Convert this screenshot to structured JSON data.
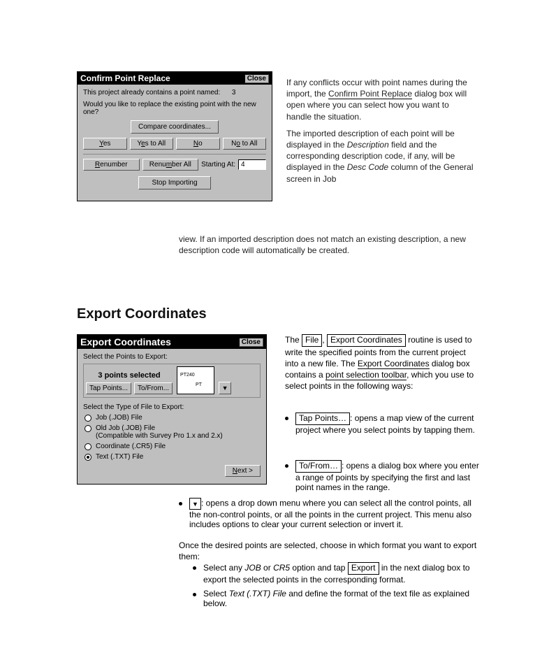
{
  "dialog1": {
    "title": "Confirm Point Replace",
    "close": "Close",
    "line1_prefix": "This project already contains a point named:",
    "line1_value": "3",
    "line2": "Would you like to replace the existing point with the new one?",
    "compare": "Compare coordinates...",
    "yes": "Yes",
    "yes_u": "Y",
    "yes_rest": "es",
    "yestoall": "Yes to All",
    "yta_pre": "Y",
    "yta_u": "e",
    "yta_post": "s to All",
    "no": "No",
    "no_u": "N",
    "no_rest": "o",
    "notoall": "No to All",
    "nta_pre": "N",
    "nta_u": "o",
    "nta_post": " to All",
    "renumber": "Renumber",
    "ren_u": "R",
    "ren_rest": "enumber",
    "renumberall": "Renumber All",
    "rena_pre": "Renu",
    "rena_u": "m",
    "rena_post": "ber All",
    "startingat": "Starting At:",
    "startingat_val": "4",
    "stop": "Stop Importing"
  },
  "rtext1": {
    "p1_pre": "If any conflicts occur with point names during the import, the ",
    "p1_em": "Confirm Point Replace",
    "p1_post": " dialog box will open where you can select how you want to handle the situation.",
    "p2_pre": "The imported description of each point will be displayed in the ",
    "p2_em": "Description",
    "p2_mid": " field and the corresponding description code, if any, will be displayed in the ",
    "p2_em2": "Desc Code",
    "p2_post": " column of the General screen in Job"
  },
  "midpara": {
    "text": "view. If an imported description does not match an existing description, a new description code will automatically be created."
  },
  "heading": "Export Coordinates",
  "dialog2": {
    "title": "Export Coordinates",
    "close": "Close",
    "select_points_label": "Select the Points to Export:",
    "sel_header": "3 points selected",
    "tap_points": "Tap Points...",
    "to_from": "To/From...",
    "map_pt1": "PT240",
    "map_pt2": "PT",
    "select_type_label": "Select the Type of File to Export:",
    "r1": "Job (.JOB) File",
    "r2a": "Old Job (.JOB) File",
    "r2b": "(Compatible with Survey Pro 1.x and 2.x)",
    "r3": "Coordinate (.CR5) File",
    "r4": "Text (.TXT) File",
    "next_u": "N",
    "next_rest": "ext >"
  },
  "rtext2": {
    "p1_pre": "The ",
    "p1_k1": "File",
    "p1_mid": ", ",
    "p1_k2": "Export Coordinates",
    "p1_post": " routine is used to write the specified points from the current project into a new file. The ",
    "p1_em1": "Export Coordinates",
    "p1_mid2": " dialog box contains a ",
    "p1_em2": "point selection toolbar",
    "p1_tail": ", which you use to select points in the following ways:"
  },
  "bullets": {
    "b1_key": "Tap Points…",
    "b1_text": ": opens a map view of the current project where you select points by tapping them.",
    "b2_key": "To/From…",
    "b2_text": ": opens a dialog box where you enter a range of points by specifying the first and last point names in the range.",
    "b3_text": ": opens a drop down menu where you can select all the control points, all the non-control points, or all the points in the current project. This menu also includes options to clear your current selection or invert it."
  },
  "lowerpara": "Once the desired points are selected, choose in which format you want to export them:",
  "b4": {
    "pre": "Select any ",
    "em": "JOB",
    "mid": " or ",
    "em2": "CR5",
    "mid2": " option and tap ",
    "key": "Export",
    "post": " in the next dialog box to export the selected points in the corresponding format."
  },
  "b5": {
    "pre": "Select ",
    "em": "Text (.TXT) File",
    "post": " and define the format of the text file as explained below."
  }
}
